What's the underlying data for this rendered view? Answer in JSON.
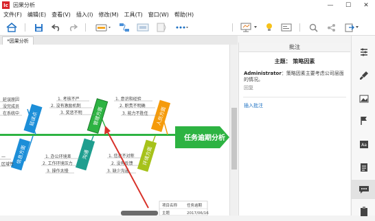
{
  "window": {
    "title": "因果分析",
    "app_badge": "Ic",
    "min_glyph": "—",
    "max_glyph": "☐",
    "close_glyph": "✕"
  },
  "menu": [
    "文件(F)",
    "编辑(E)",
    "查看(V)",
    "插入(I)",
    "修改(M)",
    "工具(T)",
    "窗口(W)",
    "帮助(H)"
  ],
  "tab": {
    "label": "*因果分析"
  },
  "diagram": {
    "head": "任务逾期分析",
    "categories": [
      {
        "label": "延误点"
      },
      {
        "label": "管理方面"
      },
      {
        "label": "人员方面"
      },
      {
        "label": "信息方面"
      },
      {
        "label": "沟通"
      },
      {
        "label": "环境方面"
      }
    ],
    "causes_left_top": [
      "延误原因",
      "没完成员",
      "在系统中"
    ],
    "causes_b": [
      "1. 考核不严",
      "2. 没有激励机制",
      "3. 奖惩不明"
    ],
    "causes_c": [
      "1. 意识和经验",
      "2. 职责不明确",
      "3. 能力不胜任"
    ],
    "causes_d": [
      "1. 办公环境差",
      "2. 工作环境压力",
      "3. 操作太慢"
    ],
    "causes_e": [
      "1. 信息不对称",
      "2. 没有反馈",
      "3. 缺少沟通"
    ],
    "causes_left_bottom": [
      "一",
      "区域性"
    ],
    "info_box": {
      "rows": [
        {
          "k": "项目名称",
          "v": "任务逾期"
        },
        {
          "k": "主题",
          "v": "2017/06/16"
        }
      ]
    }
  },
  "notes": {
    "header": "批注",
    "title": "主题：  策略因素",
    "author": "Administrator",
    "text": "：策略因素主要考虑公司层面的情况。",
    "reply": "回复",
    "add_link": "插入批注"
  },
  "colors": {
    "green": "#2db342",
    "orange": "#f59b0b",
    "blue": "#1c8ed8",
    "olive": "#a6c21a",
    "teal": "#1f9e8f",
    "arrow": "#d8322a"
  }
}
